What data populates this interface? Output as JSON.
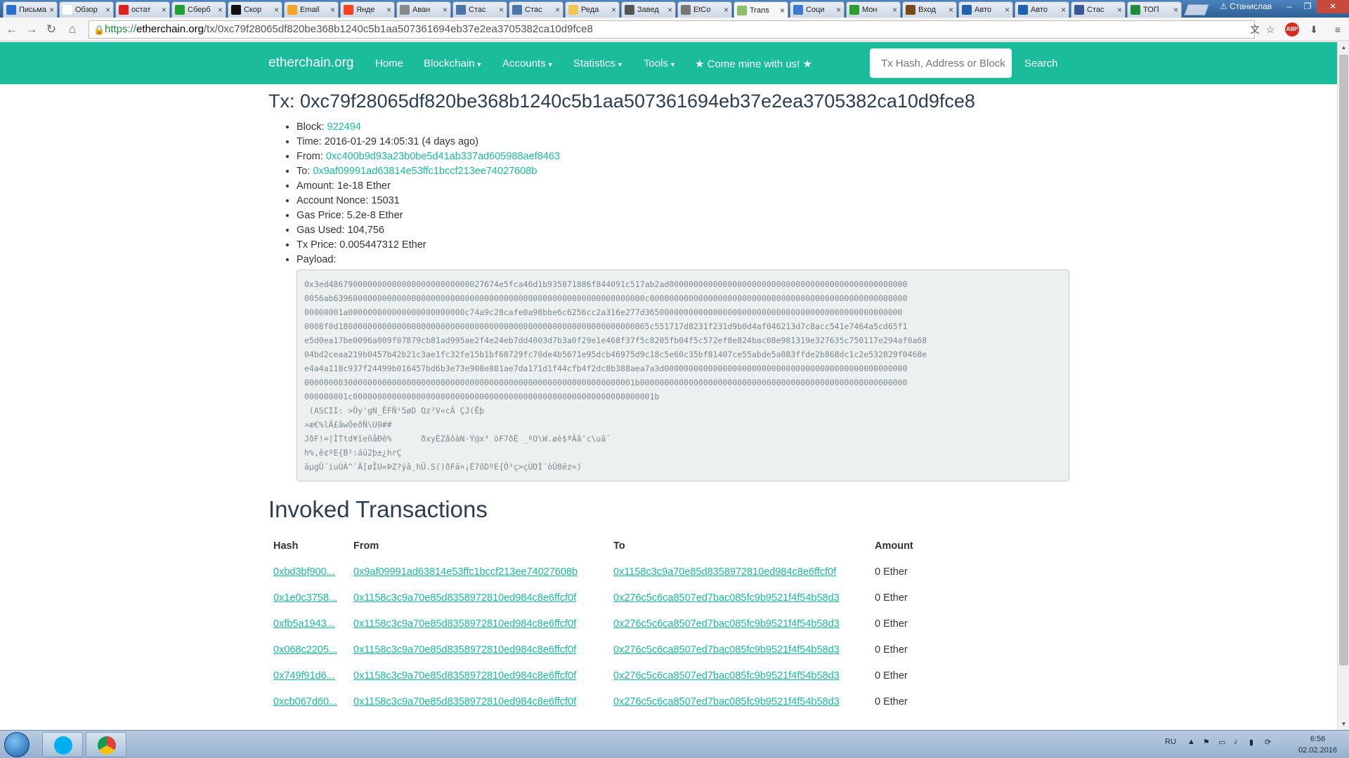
{
  "browser": {
    "tabs": [
      {
        "title": "Письма",
        "color": "#2a6fd1"
      },
      {
        "title": "Обзор",
        "color": "#ffffff"
      },
      {
        "title": "остат",
        "color": "#e02020"
      },
      {
        "title": "Сберб",
        "color": "#21a038"
      },
      {
        "title": "Скор",
        "color": "#111111"
      },
      {
        "title": "Email",
        "color": "#f5a623"
      },
      {
        "title": "Янде",
        "color": "#fc3f1d"
      },
      {
        "title": "Аван",
        "color": "#888888"
      },
      {
        "title": "Стас",
        "color": "#4a76a8"
      },
      {
        "title": "Стас",
        "color": "#4a76a8"
      },
      {
        "title": "Реда",
        "color": "#f3c650"
      },
      {
        "title": "Завед",
        "color": "#555555"
      },
      {
        "title": "EtCo",
        "color": "#777777"
      },
      {
        "title": "Trans",
        "color": "#8bbf6a"
      },
      {
        "title": "Соци",
        "color": "#3b7bd6"
      },
      {
        "title": "Мон",
        "color": "#2e9e2e"
      },
      {
        "title": "Вход",
        "color": "#7a4a1a"
      },
      {
        "title": "Авто",
        "color": "#1f63b0"
      },
      {
        "title": "Авто",
        "color": "#1f63b0"
      },
      {
        "title": "Стас",
        "color": "#3b5998"
      },
      {
        "title": "ТОП",
        "color": "#1e8e3e"
      }
    ],
    "active_tab_index": 13,
    "profile_name": "Станислав",
    "url_scheme": "https://",
    "url_host": "etherchain.org",
    "url_path": "/tx/0xc79f28065df820be368b1240c5b1aa507361694eb37e2ea3705382ca10d9fce8",
    "abp_label": "ABP"
  },
  "navbar": {
    "brand": "etherchain.org",
    "home": "Home",
    "blockchain": "Blockchain",
    "accounts": "Accounts",
    "statistics": "Statistics",
    "tools": "Tools",
    "mine": "★ Come mine with us! ★",
    "search_placeholder": "Tx Hash, Address or Block",
    "search_button": "Search",
    "accent": "#1abc9c"
  },
  "tx": {
    "title": "Tx: 0xc79f28065df820be368b1240c5b1aa507361694eb37e2ea3705382ca10d9fce8",
    "block_label": "Block: ",
    "block": "922494",
    "time": "Time: 2016-01-29 14:05:31 (4 days ago)",
    "from_label": "From: ",
    "from": "0xc400b9d93a23b0be5d41ab337ad605988aef8463",
    "to_label": "To: ",
    "to": "0x9af09991ad63814e53ffc1bccf213ee74027608b",
    "amount": "Amount: 1e-18 Ether",
    "nonce": "Account Nonce: 15031",
    "gas_price": "Gas Price: 5.2e-8 Ether",
    "gas_used": "Gas Used: 104,756",
    "tx_price": "Tx Price: 0.005447312 Ether",
    "payload_label": "Payload:",
    "payload": "0x3ed48679000000000000000000000000027674e5fca46d1b935871886f844091c517ab2ad0000000000000000000000000000000000000000000000000\n0056ab6396000000000000000000000000000000000000000000000000000000000000c00000000000000000000000000000000000000000000000000000\n00000001a000000000000000000000000c74a9c28cafe0a98bbe6c6256cc2a316e277d36500000000000000000000000000000000000000000000000000\n0008f0d1800000000000000000000000000000000000000000000000000000000000065c551717d8231f231d9b0d4af046213d7c8acc541e7464a5cd65f1\ne5d0ea17be0096a009f07879cb81ad995ae2f4e24eb7dd4003d7b3a0f29e1e468f37f5c8205fb04f5c572ef8e824bac08e981319e327635c750117e294af0a68\n04bd2ceaa219b0457b42b21c3ae1fc32fe15b1bf68729fc70de4b5671e95dcb46975d9c18c5e60c35bf81407ce55abde5a083ffde2b868dc1c2e532829f0468e\ne4a4a118c937f24499b016457bd6b3e73e908e881ae7da171d1f44cfb4f2dc8b388aea7a3d00000000000000000000000000000000000000000000000000\n00000000300000000000000000000000000000000000000000000000000000000001b0000000000000000000000000000000000000000000000000000000\n000000001c00000000000000000000000000000000000000000000000000000000000001b\n (ASCII: >Ôy'gN_ÊFÑ¹5øD Qz²V«cÀ ÇJ(Ëþ\n»æ€%lÃ£âwÓeðÑ\\U0##\nJðF!=|ÌTtd¥îeñåÐê%      ðxyÈZâôàN·Ý@x³ òF7ðÈ _ºO\\W.øè$ªÀã'c\\uâ¯\nh%,ê¢ºE{B²:áü2þ±¿hrÇ\näµgÜ´iuÙÁ^¨Ã[øÏU«ÞZ?ýâ¸hÜ.S()ðFä¤¡É7õDºE{Ó³ç>çÚDÍ´òÜ8ëz=)",
    "invoked_title": "Invoked Transactions",
    "columns": [
      "Hash",
      "From",
      "To",
      "Amount"
    ],
    "rows": [
      {
        "hash": "0xbd3bf900...",
        "from": "0x9af09991ad63814e53ffc1bccf213ee74027608b",
        "to": "0x1158c3c9a70e85d8358972810ed984c8e6ffcf0f",
        "amount": "0 Ether"
      },
      {
        "hash": "0x1e0c3758...",
        "from": "0x1158c3c9a70e85d8358972810ed984c8e6ffcf0f",
        "to": "0x276c5c6ca8507ed7bac085fc9b9521f4f54b58d3",
        "amount": "0 Ether"
      },
      {
        "hash": "0xfb5a1943...",
        "from": "0x1158c3c9a70e85d8358972810ed984c8e6ffcf0f",
        "to": "0x276c5c6ca8507ed7bac085fc9b9521f4f54b58d3",
        "amount": "0 Ether"
      },
      {
        "hash": "0x068c2205...",
        "from": "0x1158c3c9a70e85d8358972810ed984c8e6ffcf0f",
        "to": "0x276c5c6ca8507ed7bac085fc9b9521f4f54b58d3",
        "amount": "0 Ether"
      },
      {
        "hash": "0x749f91d6...",
        "from": "0x1158c3c9a70e85d8358972810ed984c8e6ffcf0f",
        "to": "0x276c5c6ca8507ed7bac085fc9b9521f4f54b58d3",
        "amount": "0 Ether"
      },
      {
        "hash": "0xcb067d60...",
        "from": "0x1158c3c9a70e85d8358972810ed984c8e6ffcf0f",
        "to": "0x276c5c6ca8507ed7bac085fc9b9521f4f54b58d3",
        "amount": "0 Ether"
      }
    ]
  },
  "taskbar": {
    "lang": "RU",
    "time": "6:56",
    "date": "02.02.2016"
  }
}
